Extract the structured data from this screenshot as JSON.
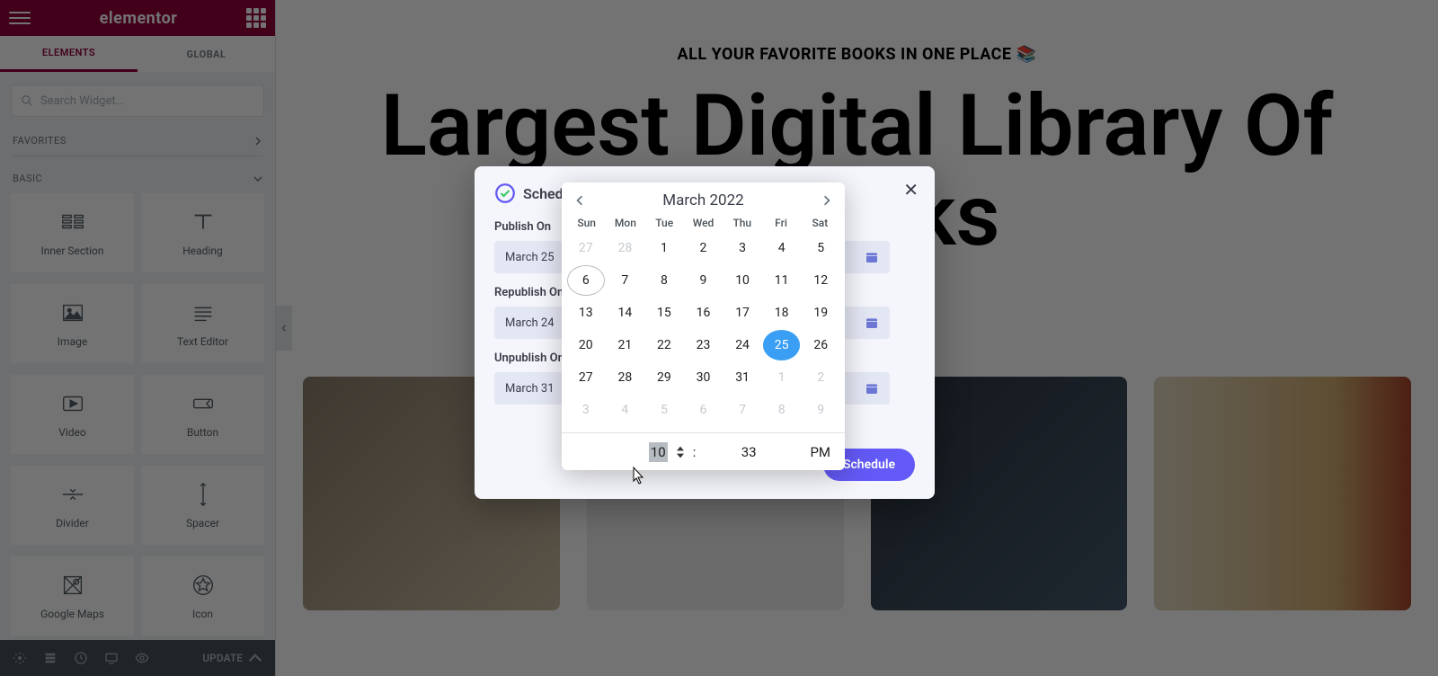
{
  "sidebar": {
    "brand": "elementor",
    "tabs": {
      "elements": "ELEMENTS",
      "global": "GLOBAL"
    },
    "search_placeholder": "Search Widget...",
    "sections": {
      "favorites": "FAVORITES",
      "basic": "BASIC"
    },
    "widgets": [
      {
        "name": "Inner Section"
      },
      {
        "name": "Heading"
      },
      {
        "name": "Image"
      },
      {
        "name": "Text Editor"
      },
      {
        "name": "Video"
      },
      {
        "name": "Button"
      },
      {
        "name": "Divider"
      },
      {
        "name": "Spacer"
      },
      {
        "name": "Google Maps"
      },
      {
        "name": "Icon"
      }
    ],
    "update": "UPDATE"
  },
  "page": {
    "tagline": "ALL YOUR FAVORITE BOOKS IN ONE PLACE 📚",
    "title_line1": "Largest Digital Library Of",
    "title_line2": "eBooks"
  },
  "modal": {
    "brand": "SchedulePress",
    "fields": {
      "publish": {
        "label": "Publish On",
        "value": "March 25"
      },
      "republish": {
        "label": "Republish On",
        "value": "March 24"
      },
      "unpublish": {
        "label": "Unpublish On",
        "value": "March 31"
      }
    },
    "schedule_btn": "Schedule"
  },
  "calendar": {
    "month": "March 2022",
    "dow": [
      "Sun",
      "Mon",
      "Tue",
      "Wed",
      "Thu",
      "Fri",
      "Sat"
    ],
    "prev_trail": [
      27,
      28
    ],
    "days_in_month": 31,
    "next_trail": [
      1,
      2,
      3,
      4,
      5,
      6,
      7,
      8,
      9
    ],
    "today": 6,
    "selected": 25,
    "time": {
      "hour": "10",
      "minute": "33",
      "ampm": "PM"
    }
  }
}
